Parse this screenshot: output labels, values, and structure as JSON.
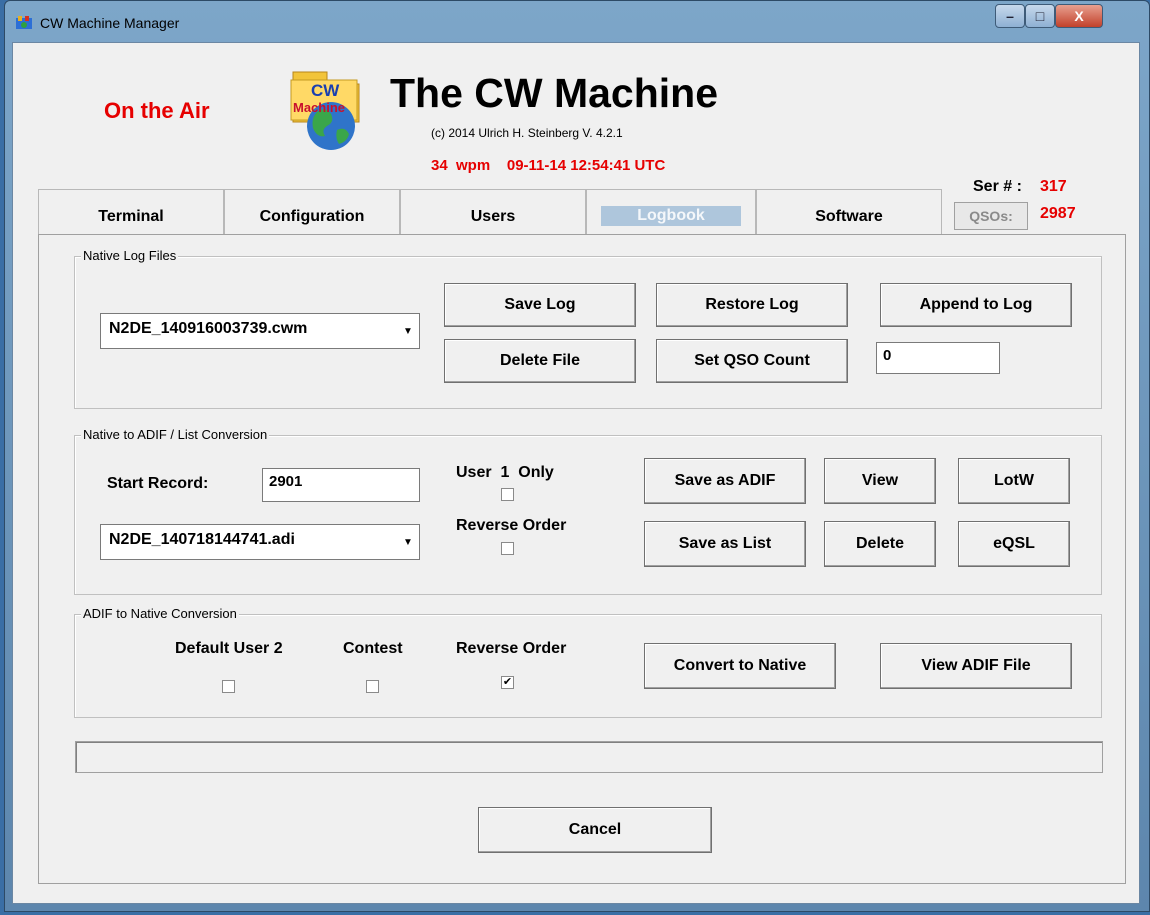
{
  "window": {
    "title": "CW Machine Manager",
    "minimize_glyph": "–",
    "maximize_glyph": "□",
    "close_glyph": "X"
  },
  "header": {
    "on_air": "On the Air",
    "logo_text_top": "CW",
    "logo_text_bottom": "Machine",
    "app_title": "The CW Machine",
    "copyright": "(c)  2014 Ulrich H. Steinberg   V. 4.2.1",
    "wpm": "34  wpm",
    "datetime": "09-11-14 12:54:41 UTC",
    "ser_label": "Ser # :",
    "ser_value": "317",
    "qsos_label": "QSOs:",
    "qsos_value": "2987"
  },
  "tabs": [
    {
      "label": "Terminal"
    },
    {
      "label": "Configuration"
    },
    {
      "label": "Users"
    },
    {
      "label": "Logbook",
      "active": true
    },
    {
      "label": "Software"
    }
  ],
  "native_log": {
    "title": "Native Log Files",
    "file_selected": "N2DE_140916003739.cwm",
    "save_log": "Save Log",
    "restore_log": "Restore Log",
    "append_to_log": "Append to Log",
    "delete_file": "Delete File",
    "set_qso_count": "Set QSO Count",
    "qso_count_value": "0"
  },
  "adif_conversion": {
    "title": "Native to ADIF / List Conversion",
    "start_record_label": "Start Record:",
    "start_record_value": "2901",
    "user_only_label": "User  1  Only",
    "user_only_checked": false,
    "reverse_order_label": "Reverse Order",
    "reverse_order_checked": false,
    "file_selected": "N2DE_140718144741.adi",
    "save_as_adif": "Save as ADIF",
    "view": "View",
    "lotw": "LotW",
    "save_as_list": "Save as List",
    "delete": "Delete",
    "eqsl": "eQSL"
  },
  "native_conversion": {
    "title": "ADIF to Native Conversion",
    "default_user_label": "Default User 2",
    "default_user_checked": false,
    "contest_label": "Contest",
    "contest_checked": false,
    "reverse_order_label": "Reverse Order",
    "reverse_order_checked": true,
    "convert_to_native": "Convert to Native",
    "view_adif_file": "View ADIF File"
  },
  "footer": {
    "cancel": "Cancel"
  },
  "colors": {
    "accent_red": "#e60000",
    "active_tab_bg": "#aec6dc"
  }
}
